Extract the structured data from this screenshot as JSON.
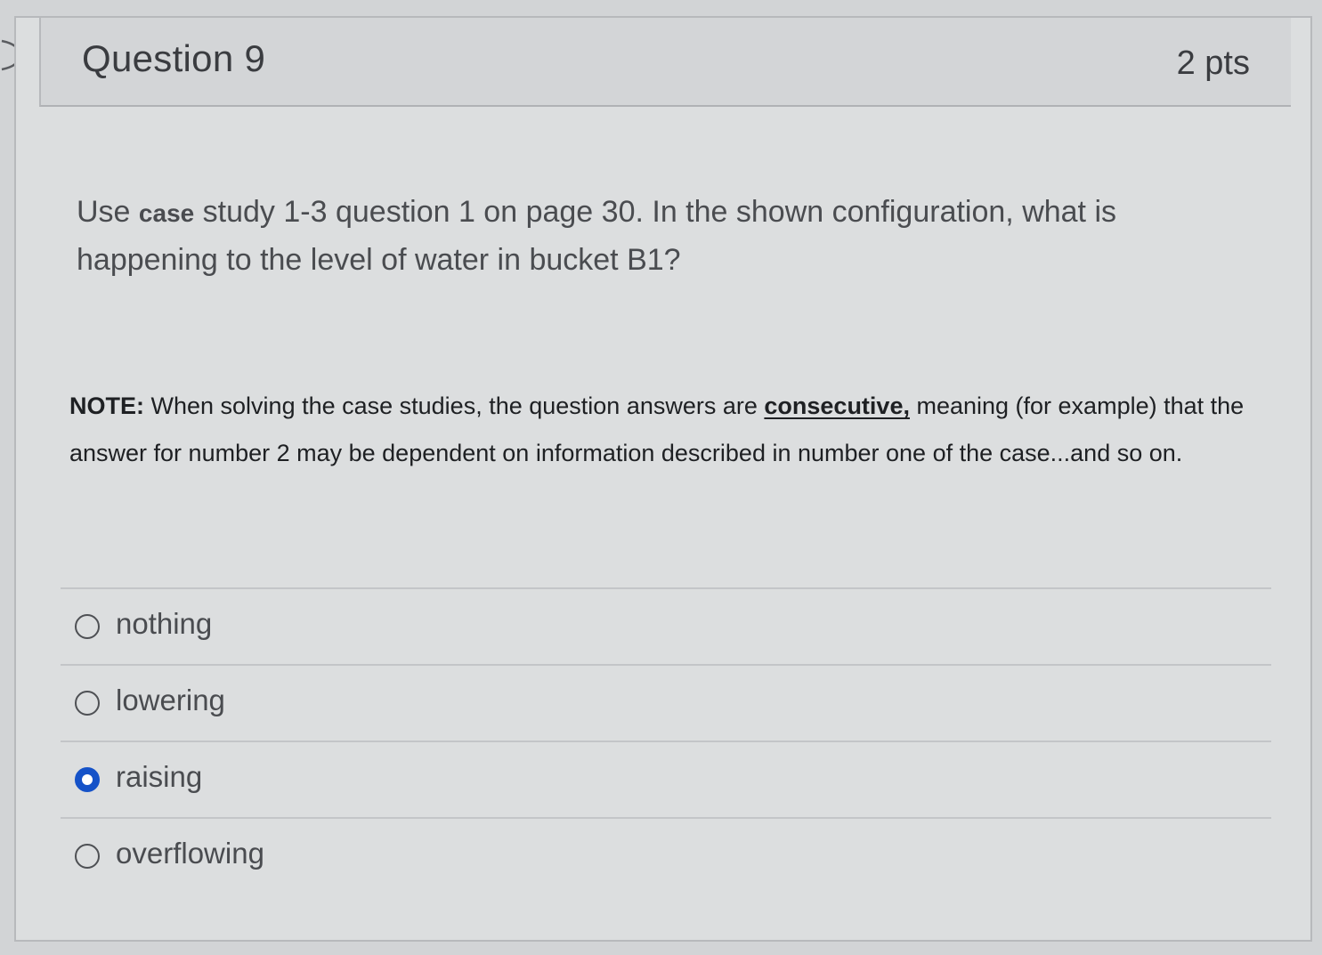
{
  "question": {
    "title": "Question 9",
    "points": "2 pts",
    "text_part1": "Use ",
    "text_case": "case",
    "text_part2": " study 1-3 question 1 on page 30.  In the shown configuration, what is happening to the level of water in bucket B1?",
    "note_label": "NOTE:",
    "note_part1": " When solving the case studies, the question answers are ",
    "note_emphasis": "consecutive,",
    "note_part2": " meaning (for example) that the answer for number 2 may be dependent on information described in number one of the case...and so on.",
    "answers": [
      {
        "label": "nothing",
        "selected": false
      },
      {
        "label": "lowering",
        "selected": false
      },
      {
        "label": "raising",
        "selected": true
      },
      {
        "label": "overflowing",
        "selected": false
      }
    ]
  },
  "colors": {
    "selected_radio": "#1552c8"
  },
  "icons": {
    "side_arrow": "chevron-right-icon"
  }
}
